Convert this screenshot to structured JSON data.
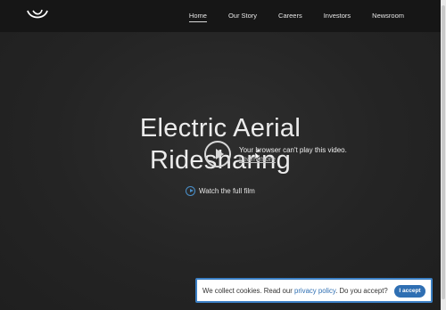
{
  "nav": {
    "items": [
      {
        "label": "Home",
        "active": true
      },
      {
        "label": "Our Story",
        "active": false
      },
      {
        "label": "Careers",
        "active": false
      },
      {
        "label": "Investors",
        "active": false
      },
      {
        "label": "Newsroom",
        "active": false
      }
    ]
  },
  "hero": {
    "title_line1": "Electric Aerial",
    "title_line2": "Ridesharing",
    "video_error": "Your browser can't play this video.",
    "video_link": "Learn more",
    "watch_label": "Watch the full film"
  },
  "cookie": {
    "text_before": "We collect cookies. Read our ",
    "link_text": "privacy policy",
    "text_after": ". Do you accept?",
    "accept_label": "I accept"
  },
  "colors": {
    "background": "#262626",
    "accent": "#2f6fb3"
  },
  "icons": [
    "logo-icon",
    "play-icon",
    "cursor-icon",
    "watch-play-icon"
  ]
}
